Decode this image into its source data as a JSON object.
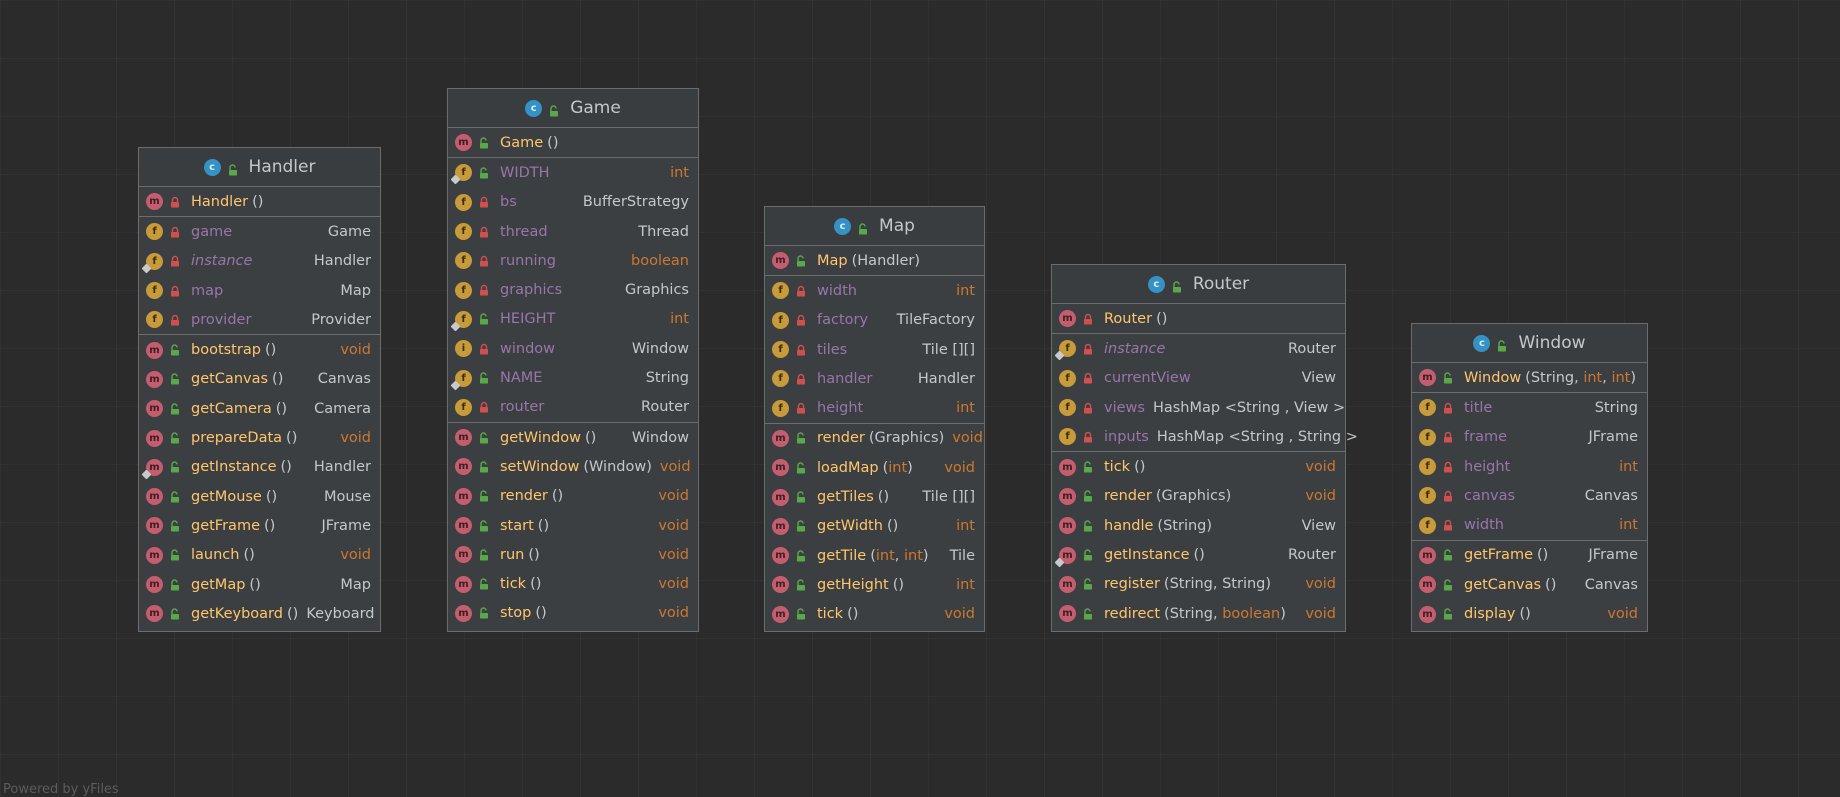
{
  "diagram": {
    "classes": [
      {
        "id": "handler",
        "name": "Handler",
        "sections": [
          [
            {
              "kind": "m",
              "vis": "private",
              "name": "Handler",
              "params": [],
              "type": ""
            }
          ],
          [
            {
              "kind": "f",
              "vis": "private",
              "name": "game",
              "type": "Game"
            },
            {
              "kind": "f",
              "vis": "private",
              "name": "instance",
              "type": "Handler",
              "italic": true,
              "static": true
            },
            {
              "kind": "f",
              "vis": "private",
              "name": "map",
              "type": "Map"
            },
            {
              "kind": "f",
              "vis": "private",
              "name": "provider",
              "type": "Provider"
            }
          ],
          [
            {
              "kind": "m",
              "vis": "public",
              "name": "bootstrap",
              "params": [],
              "type": "void"
            },
            {
              "kind": "m",
              "vis": "public",
              "name": "getCanvas",
              "params": [],
              "type": "Canvas"
            },
            {
              "kind": "m",
              "vis": "public",
              "name": "getCamera",
              "params": [],
              "type": "Camera"
            },
            {
              "kind": "m",
              "vis": "public",
              "name": "prepareData",
              "params": [],
              "type": "void"
            },
            {
              "kind": "m",
              "vis": "public",
              "name": "getInstance",
              "params": [],
              "type": "Handler",
              "static": true
            },
            {
              "kind": "m",
              "vis": "public",
              "name": "getMouse",
              "params": [],
              "type": "Mouse"
            },
            {
              "kind": "m",
              "vis": "public",
              "name": "getFrame",
              "params": [],
              "type": "JFrame"
            },
            {
              "kind": "m",
              "vis": "public",
              "name": "launch",
              "params": [],
              "type": "void"
            },
            {
              "kind": "m",
              "vis": "public",
              "name": "getMap",
              "params": [],
              "type": "Map"
            },
            {
              "kind": "m",
              "vis": "public",
              "name": "getKeyboard",
              "params": [],
              "type": "Keyboard"
            }
          ]
        ]
      },
      {
        "id": "game",
        "name": "Game",
        "sections": [
          [
            {
              "kind": "m",
              "vis": "public",
              "name": "Game",
              "params": [],
              "type": ""
            }
          ],
          [
            {
              "kind": "f",
              "vis": "public",
              "name": "WIDTH",
              "type": "int",
              "static": true
            },
            {
              "kind": "f",
              "vis": "private",
              "name": "bs",
              "type": "BufferStrategy"
            },
            {
              "kind": "f",
              "vis": "private",
              "name": "thread",
              "type": "Thread"
            },
            {
              "kind": "f",
              "vis": "private",
              "name": "running",
              "type": "boolean"
            },
            {
              "kind": "f",
              "vis": "private",
              "name": "graphics",
              "type": "Graphics"
            },
            {
              "kind": "f",
              "vis": "public",
              "name": "HEIGHT",
              "type": "int",
              "static": true
            },
            {
              "kind": "i",
              "vis": "private",
              "name": "window",
              "type": "Window"
            },
            {
              "kind": "f",
              "vis": "public",
              "name": "NAME",
              "type": "String",
              "static": true
            },
            {
              "kind": "f",
              "vis": "private",
              "name": "router",
              "type": "Router"
            }
          ],
          [
            {
              "kind": "m",
              "vis": "public",
              "name": "getWindow",
              "params": [],
              "type": "Window"
            },
            {
              "kind": "m",
              "vis": "public",
              "name": "setWindow",
              "params": [
                "Window"
              ],
              "type": "void"
            },
            {
              "kind": "m",
              "vis": "public",
              "name": "render",
              "params": [],
              "type": "void"
            },
            {
              "kind": "m",
              "vis": "public",
              "name": "start",
              "params": [],
              "type": "void"
            },
            {
              "kind": "m",
              "vis": "public",
              "name": "run",
              "params": [],
              "type": "void"
            },
            {
              "kind": "m",
              "vis": "public",
              "name": "tick",
              "params": [],
              "type": "void"
            },
            {
              "kind": "m",
              "vis": "public",
              "name": "stop",
              "params": [],
              "type": "void"
            }
          ]
        ]
      },
      {
        "id": "map",
        "name": "Map",
        "sections": [
          [
            {
              "kind": "m",
              "vis": "public",
              "name": "Map",
              "params": [
                "Handler"
              ],
              "type": ""
            }
          ],
          [
            {
              "kind": "f",
              "vis": "private",
              "name": "width",
              "type": "int"
            },
            {
              "kind": "f",
              "vis": "private",
              "name": "factory",
              "type": "TileFactory"
            },
            {
              "kind": "f",
              "vis": "private",
              "name": "tiles",
              "type": "Tile [][]"
            },
            {
              "kind": "f",
              "vis": "private",
              "name": "handler",
              "type": "Handler"
            },
            {
              "kind": "f",
              "vis": "private",
              "name": "height",
              "type": "int"
            }
          ],
          [
            {
              "kind": "m",
              "vis": "public",
              "name": "render",
              "params": [
                "Graphics"
              ],
              "type": "void"
            },
            {
              "kind": "m",
              "vis": "public",
              "name": "loadMap",
              "params": [
                "int"
              ],
              "type": "void"
            },
            {
              "kind": "m",
              "vis": "public",
              "name": "getTiles",
              "params": [],
              "type": "Tile [][]"
            },
            {
              "kind": "m",
              "vis": "public",
              "name": "getWidth",
              "params": [],
              "type": "int"
            },
            {
              "kind": "m",
              "vis": "public",
              "name": "getTile",
              "params": [
                "int",
                "int"
              ],
              "type": "Tile"
            },
            {
              "kind": "m",
              "vis": "public",
              "name": "getHeight",
              "params": [],
              "type": "int"
            },
            {
              "kind": "m",
              "vis": "public",
              "name": "tick",
              "params": [],
              "type": "void"
            }
          ]
        ]
      },
      {
        "id": "router",
        "name": "Router",
        "sections": [
          [
            {
              "kind": "m",
              "vis": "private",
              "name": "Router",
              "params": [],
              "type": ""
            }
          ],
          [
            {
              "kind": "f",
              "vis": "private",
              "name": "instance",
              "type": "Router",
              "italic": true,
              "static": true
            },
            {
              "kind": "f",
              "vis": "private",
              "name": "currentView",
              "type": "View"
            },
            {
              "kind": "f",
              "vis": "private",
              "name": "views",
              "type": "HashMap <String , View >"
            },
            {
              "kind": "f",
              "vis": "private",
              "name": "inputs",
              "type": "HashMap <String , String >"
            }
          ],
          [
            {
              "kind": "m",
              "vis": "public",
              "name": "tick",
              "params": [],
              "type": "void"
            },
            {
              "kind": "m",
              "vis": "public",
              "name": "render",
              "params": [
                "Graphics"
              ],
              "type": "void"
            },
            {
              "kind": "m",
              "vis": "public",
              "name": "handle",
              "params": [
                "String"
              ],
              "type": "View"
            },
            {
              "kind": "m",
              "vis": "public",
              "name": "getInstance",
              "params": [],
              "type": "Router",
              "static": true
            },
            {
              "kind": "m",
              "vis": "public",
              "name": "register",
              "params": [
                "String",
                "String"
              ],
              "type": "void"
            },
            {
              "kind": "m",
              "vis": "public",
              "name": "redirect",
              "params": [
                "String",
                "boolean"
              ],
              "type": "void"
            }
          ]
        ]
      },
      {
        "id": "window",
        "name": "Window",
        "sections": [
          [
            {
              "kind": "m",
              "vis": "public",
              "name": "Window",
              "params": [
                "String",
                "int",
                "int"
              ],
              "type": ""
            }
          ],
          [
            {
              "kind": "f",
              "vis": "private",
              "name": "title",
              "type": "String"
            },
            {
              "kind": "f",
              "vis": "private",
              "name": "frame",
              "type": "JFrame"
            },
            {
              "kind": "f",
              "vis": "private",
              "name": "height",
              "type": "int"
            },
            {
              "kind": "f",
              "vis": "private",
              "name": "canvas",
              "type": "Canvas"
            },
            {
              "kind": "f",
              "vis": "private",
              "name": "width",
              "type": "int"
            }
          ],
          [
            {
              "kind": "m",
              "vis": "public",
              "name": "getFrame",
              "params": [],
              "type": "JFrame"
            },
            {
              "kind": "m",
              "vis": "public",
              "name": "getCanvas",
              "params": [],
              "type": "Canvas"
            },
            {
              "kind": "m",
              "vis": "public",
              "name": "display",
              "params": [],
              "type": "void"
            }
          ]
        ]
      }
    ]
  },
  "watermark": "Powered by yFiles",
  "colors": {
    "background": "#2b2b2b",
    "box": "#3c3f41",
    "method_name": "#ffc66d",
    "field_name": "#9876aa",
    "primitive_type": "#cc7832",
    "text": "#c5c8ca",
    "class_icon": "#3592c4",
    "method_icon": "#c45e6f",
    "field_icon": "#c79a3a"
  },
  "icons": {
    "class": "class-c-icon",
    "method": "method-m-icon",
    "field": "field-f-icon",
    "private": "lock-closed-icon",
    "public": "lock-open-icon",
    "static": "pin-icon"
  }
}
